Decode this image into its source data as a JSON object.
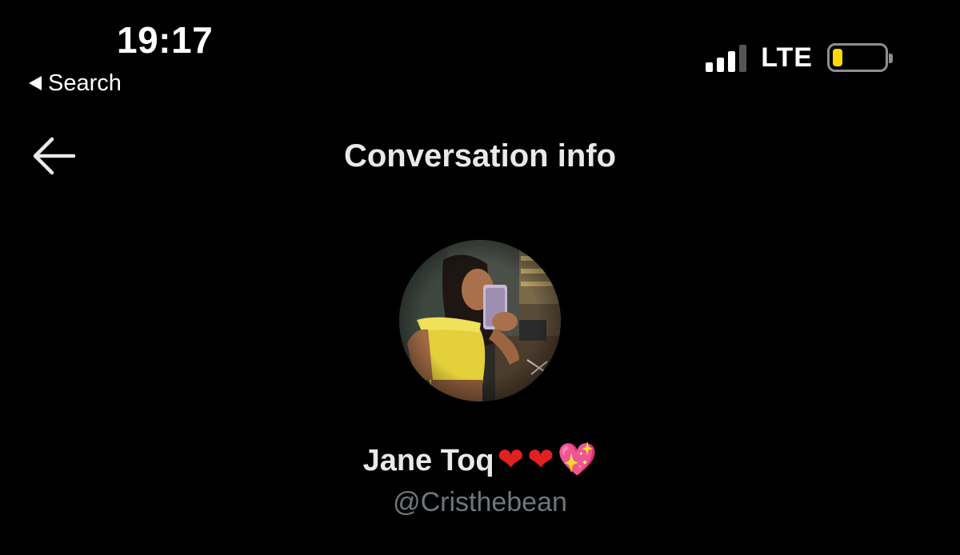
{
  "status_bar": {
    "time": "19:17",
    "back_to_app": "Search",
    "network": "LTE",
    "signal_bars_active": 3,
    "signal_bars_total": 4,
    "battery_level": 0.2,
    "battery_color": "#ffd60a"
  },
  "header": {
    "title": "Conversation info",
    "back_icon": "arrow-left-icon"
  },
  "profile": {
    "display_name": "Jane Toq",
    "name_emojis": [
      "❤",
      "❤",
      "💖"
    ],
    "handle": "@Cristhebean",
    "avatar": "profile-photo"
  },
  "colors": {
    "background": "#000000",
    "primary_text": "#e7e9ea",
    "secondary_text": "#71767b"
  }
}
